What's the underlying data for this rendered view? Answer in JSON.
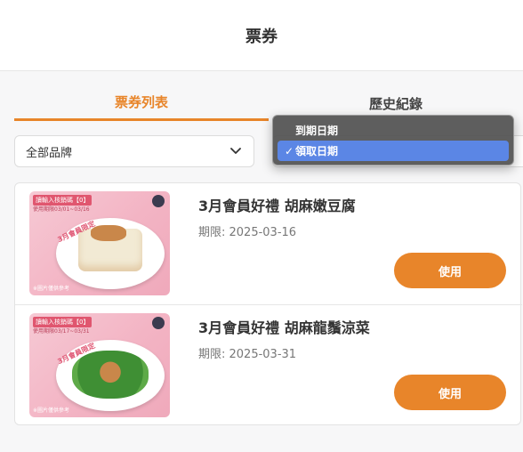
{
  "header": {
    "title": "票券"
  },
  "tabs": [
    {
      "label": "票券列表",
      "active": true
    },
    {
      "label": "歷史紀錄",
      "active": false
    }
  ],
  "filters": {
    "brand": {
      "selected": "全部品牌"
    },
    "sort": {
      "options": [
        {
          "label": "到期日期",
          "selected": false
        },
        {
          "label": "領取日期",
          "selected": true
        }
      ],
      "check_mark": "✓"
    }
  },
  "coupons": [
    {
      "title": "3月會員好禮 胡麻嫩豆腐",
      "expiry_label": "期限: 2025-03-16",
      "button_label": "使用",
      "image": {
        "badge": "讀輸入核銷碼【0】",
        "date": "使用期限03/01~03/16",
        "ribbon": "3月會員限定",
        "note": "※圖片僅供參考",
        "dish": "tofu"
      }
    },
    {
      "title": "3月會員好禮 胡麻龍鬚涼菜",
      "expiry_label": "期限: 2025-03-31",
      "button_label": "使用",
      "image": {
        "badge": "讀輸入核銷碼【0】",
        "date": "使用期限03/17~03/31",
        "ribbon": "3月會員限定",
        "note": "※圖片僅供參考",
        "dish": "greens"
      }
    }
  ],
  "colors": {
    "accent": "#e8852a",
    "selection": "#5b86e5"
  }
}
